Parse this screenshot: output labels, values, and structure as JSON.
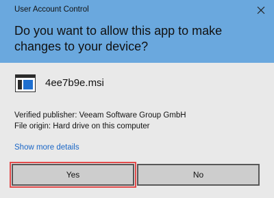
{
  "window": {
    "title": "User Account Control",
    "close_icon": "close-icon"
  },
  "prompt": {
    "question": "Do you want to allow this app to make changes to your device?"
  },
  "app": {
    "icon": "installer-file-icon",
    "file_name": "4ee7b9e.msi",
    "publisher": "Verified publisher: Veeam Software Group GmbH",
    "origin": "File origin: Hard drive on this computer"
  },
  "links": {
    "show_more": "Show more details"
  },
  "buttons": {
    "yes": "Yes",
    "no": "No"
  },
  "colors": {
    "header": "#6aa8de",
    "body": "#e9e9e9",
    "link": "#1a66c6",
    "highlight": "#e24a4a"
  }
}
